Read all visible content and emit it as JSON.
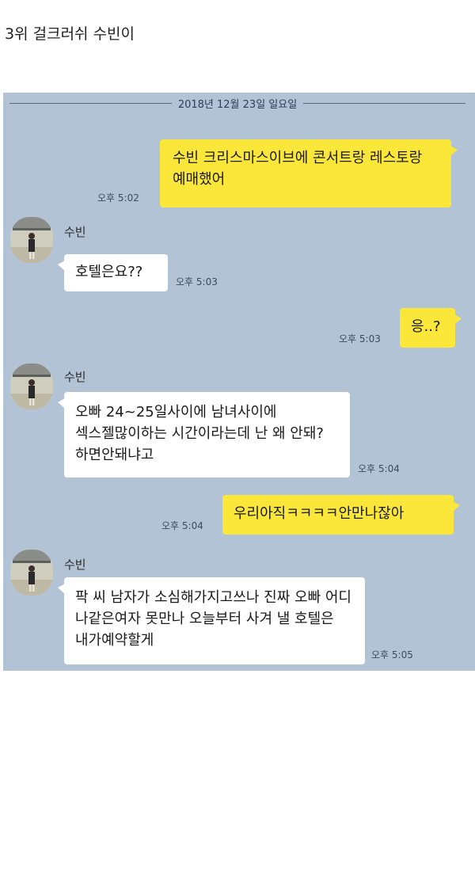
{
  "post": {
    "title": "3위 걸크러쉬 수빈이"
  },
  "chat": {
    "date": "2018년 12월 23일 일요일",
    "messages": [
      {
        "from": "me",
        "text": "수빈 크리스마스이브에 콘서트랑 레스토랑 예매했어",
        "time": "오후 5:02"
      },
      {
        "from": "other",
        "sender": "수빈",
        "text": "호텔은요??",
        "time": "오후 5:03"
      },
      {
        "from": "me",
        "text": "응..?",
        "time": "오후 5:03"
      },
      {
        "from": "other",
        "sender": "수빈",
        "text": "오빠 24~25일사이에 남녀사이에 섹스젤많이하는 시간이라는데 난 왜 안돼?하면안돼냐고",
        "time": "오후 5:04"
      },
      {
        "from": "me",
        "text": "우리아직ㅋㅋㅋㅋ안만나잖아",
        "time": "오후 5:04"
      },
      {
        "from": "other",
        "sender": "수빈",
        "text": "팍 씨 남자가 소심해가지고쓰나 진짜 오빠 어디 나같은여자 못만나 오늘부터 사겨 낼 호텔은 내가예약할게",
        "time": "오후 5:05"
      }
    ]
  }
}
